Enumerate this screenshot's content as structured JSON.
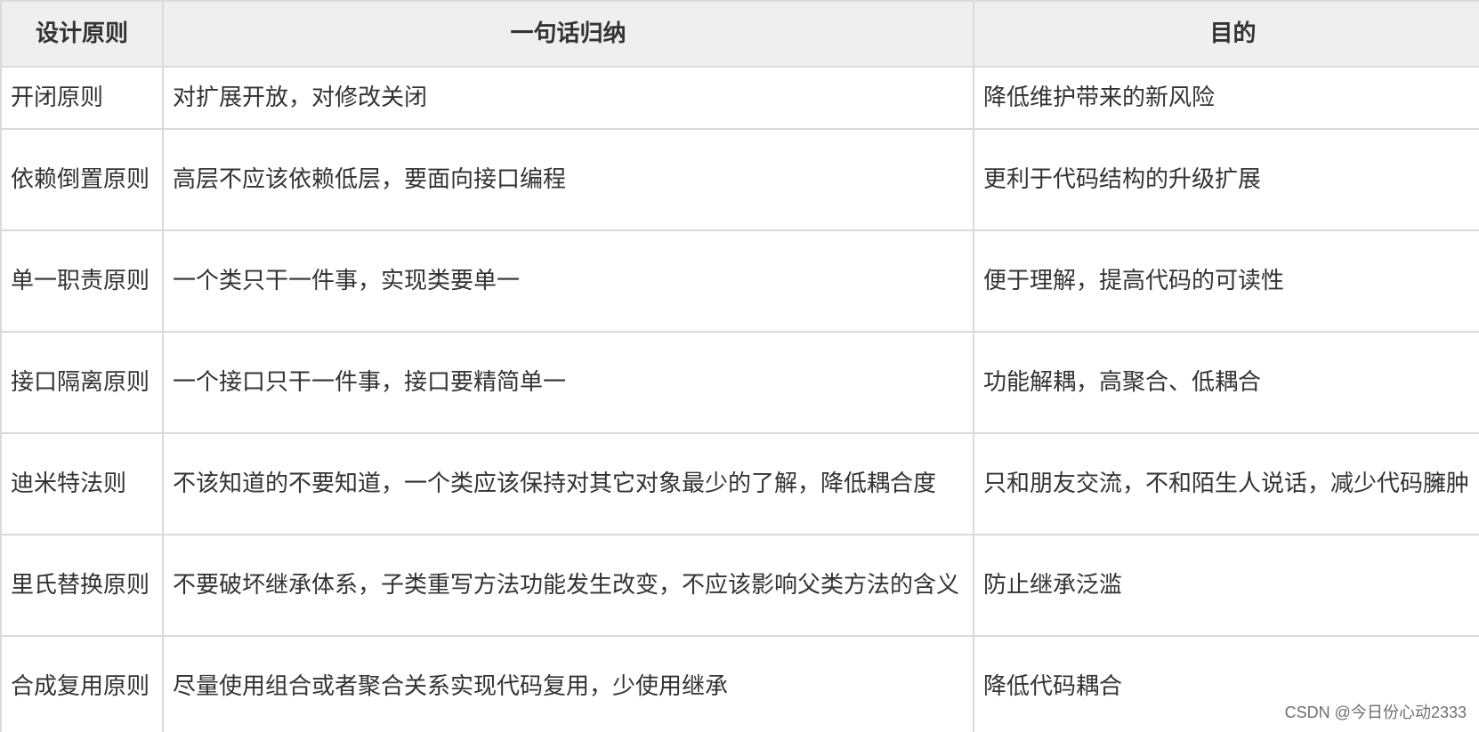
{
  "table": {
    "headers": [
      "设计原则",
      "一句话归纳",
      "目的"
    ],
    "rows": [
      {
        "principle": "开闭原则",
        "summary": "对扩展开放，对修改关闭",
        "purpose": "降低维护带来的新风险"
      },
      {
        "principle": "依赖倒置原则",
        "summary": "高层不应该依赖低层，要面向接口编程",
        "purpose": "更利于代码结构的升级扩展"
      },
      {
        "principle": "单一职责原则",
        "summary": "一个类只干一件事，实现类要单一",
        "purpose": "便于理解，提高代码的可读性"
      },
      {
        "principle": "接口隔离原则",
        "summary": "一个接口只干一件事，接口要精简单一",
        "purpose": "功能解耦，高聚合、低耦合"
      },
      {
        "principle": "迪米特法则",
        "summary": "不该知道的不要知道，一个类应该保持对其它对象最少的了解，降低耦合度",
        "purpose": "只和朋友交流，不和陌生人说话，减少代码臃肿"
      },
      {
        "principle": "里氏替换原则",
        "summary": "不要破坏继承体系，子类重写方法功能发生改变，不应该影响父类方法的含义",
        "purpose": "防止继承泛滥"
      },
      {
        "principle": "合成复用原则",
        "summary": "尽量使用组合或者聚合关系实现代码复用，少使用继承",
        "purpose": "降低代码耦合"
      }
    ]
  },
  "watermark": "CSDN @今日份心动2333"
}
